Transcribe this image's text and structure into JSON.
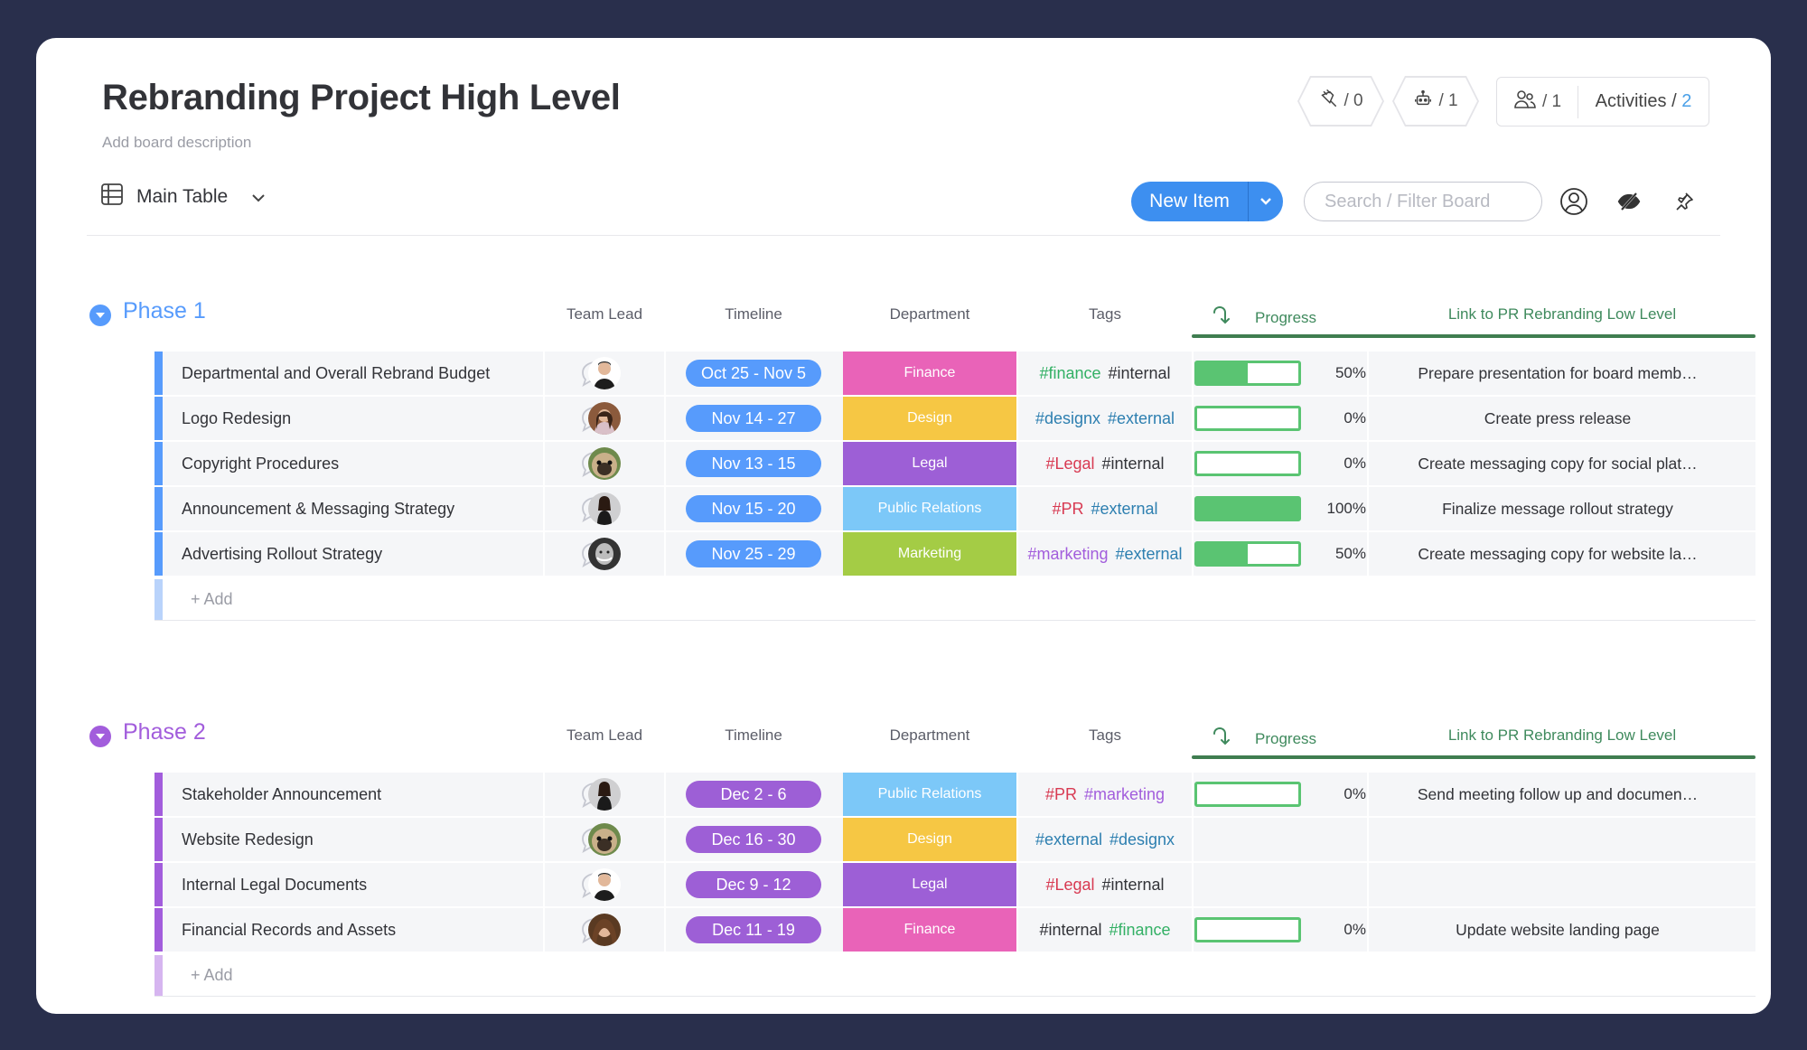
{
  "board": {
    "title": "Rebranding Project High Level",
    "description": "Add board description",
    "integrations_count": "/ 0",
    "automations_count": "/ 1",
    "members_count": "/ 1",
    "activities_label": "Activities /",
    "activities_count": "2"
  },
  "view": {
    "name": "Main Table",
    "new_item_label": "New Item",
    "search_placeholder": "Search / Filter Board"
  },
  "columns": {
    "team_lead": "Team Lead",
    "timeline": "Timeline",
    "department": "Department",
    "tags": "Tags",
    "progress": "Progress",
    "link": "Link to PR Rebranding Low Level"
  },
  "colors": {
    "phase1": "#579bfc",
    "phase1_add": "#b9d3fb",
    "phase2": "#a25ddc",
    "phase2_add": "#d6b5f0",
    "timeline_phase2": "#9d5fd6",
    "dept": {
      "Finance": "#e963b8",
      "Design": "#f6c744",
      "Legal": "#9d5fd6",
      "Public Relations": "#7cc8f8",
      "Marketing": "#a4cc45"
    },
    "tag": {
      "green": "#33b065",
      "dark": "#323338",
      "blue": "#2d7fb0",
      "red": "#d83a52",
      "purple": "#a25ddc"
    }
  },
  "add_label": "+ Add",
  "groups": [
    {
      "title": "Phase 1",
      "color": "#579bfc",
      "items": [
        {
          "name": "Departmental and Overall Rebrand Budget",
          "avatar": "man-dark-shirt",
          "timeline": "Oct 25 - Nov 5",
          "department": "Finance",
          "tags": [
            {
              "text": "#finance",
              "color": "green"
            },
            {
              "text": "#internal",
              "color": "dark"
            }
          ],
          "progress": 50,
          "progress_label": "50%",
          "link": "Prepare presentation for board memb…"
        },
        {
          "name": "Logo Redesign",
          "avatar": "woman-long-hair",
          "timeline": "Nov 14 - 27",
          "department": "Design",
          "tags": [
            {
              "text": "#designx",
              "color": "blue"
            },
            {
              "text": "#external",
              "color": "blue"
            }
          ],
          "progress": 0,
          "progress_label": "0%",
          "link": "Create press release"
        },
        {
          "name": "Copyright Procedures",
          "avatar": "pug-dog",
          "timeline": "Nov 13 - 15",
          "department": "Legal",
          "tags": [
            {
              "text": "#Legal",
              "color": "red"
            },
            {
              "text": "#internal",
              "color": "dark"
            }
          ],
          "progress": 0,
          "progress_label": "0%",
          "link": "Create messaging copy for social plat…"
        },
        {
          "name": "Announcement & Messaging Strategy",
          "avatar": "woman-standing",
          "timeline": "Nov 15 - 20",
          "department": "Public Relations",
          "tags": [
            {
              "text": "#PR",
              "color": "red"
            },
            {
              "text": "#external",
              "color": "blue"
            }
          ],
          "progress": 100,
          "progress_label": "100%",
          "link": "Finalize message rollout strategy"
        },
        {
          "name": "Advertising Rollout Strategy",
          "avatar": "woman-bw",
          "timeline": "Nov 25 - 29",
          "department": "Marketing",
          "tags": [
            {
              "text": "#marketing",
              "color": "purple"
            },
            {
              "text": "#external",
              "color": "blue"
            }
          ],
          "progress": 50,
          "progress_label": "50%",
          "link": "Create messaging copy for website la…"
        }
      ]
    },
    {
      "title": "Phase 2",
      "color": "#a25ddc",
      "items": [
        {
          "name": "Stakeholder Announcement",
          "avatar": "woman-standing",
          "timeline": "Dec 2 - 6",
          "department": "Public Relations",
          "tags": [
            {
              "text": "#PR",
              "color": "red"
            },
            {
              "text": "#marketing",
              "color": "purple"
            }
          ],
          "progress": 0,
          "progress_label": "0%",
          "link": "Send meeting follow up and documen…"
        },
        {
          "name": "Website Redesign",
          "avatar": "pug-dog",
          "timeline": "Dec 16 - 30",
          "department": "Design",
          "tags": [
            {
              "text": "#external",
              "color": "blue"
            },
            {
              "text": "#designx",
              "color": "blue"
            }
          ],
          "progress": null,
          "progress_label": "",
          "link": ""
        },
        {
          "name": "Internal Legal Documents",
          "avatar": "man-dark-shirt",
          "timeline": "Dec 9 - 12",
          "department": "Legal",
          "tags": [
            {
              "text": "#Legal",
              "color": "red"
            },
            {
              "text": "#internal",
              "color": "dark"
            }
          ],
          "progress": null,
          "progress_label": "",
          "link": ""
        },
        {
          "name": "Financial Records and Assets",
          "avatar": "woman-curly-hair",
          "timeline": "Dec 11 - 19",
          "department": "Finance",
          "tags": [
            {
              "text": "#internal",
              "color": "dark"
            },
            {
              "text": "#finance",
              "color": "green"
            }
          ],
          "progress": 0,
          "progress_label": "0%",
          "link": "Update website landing page"
        }
      ]
    }
  ]
}
